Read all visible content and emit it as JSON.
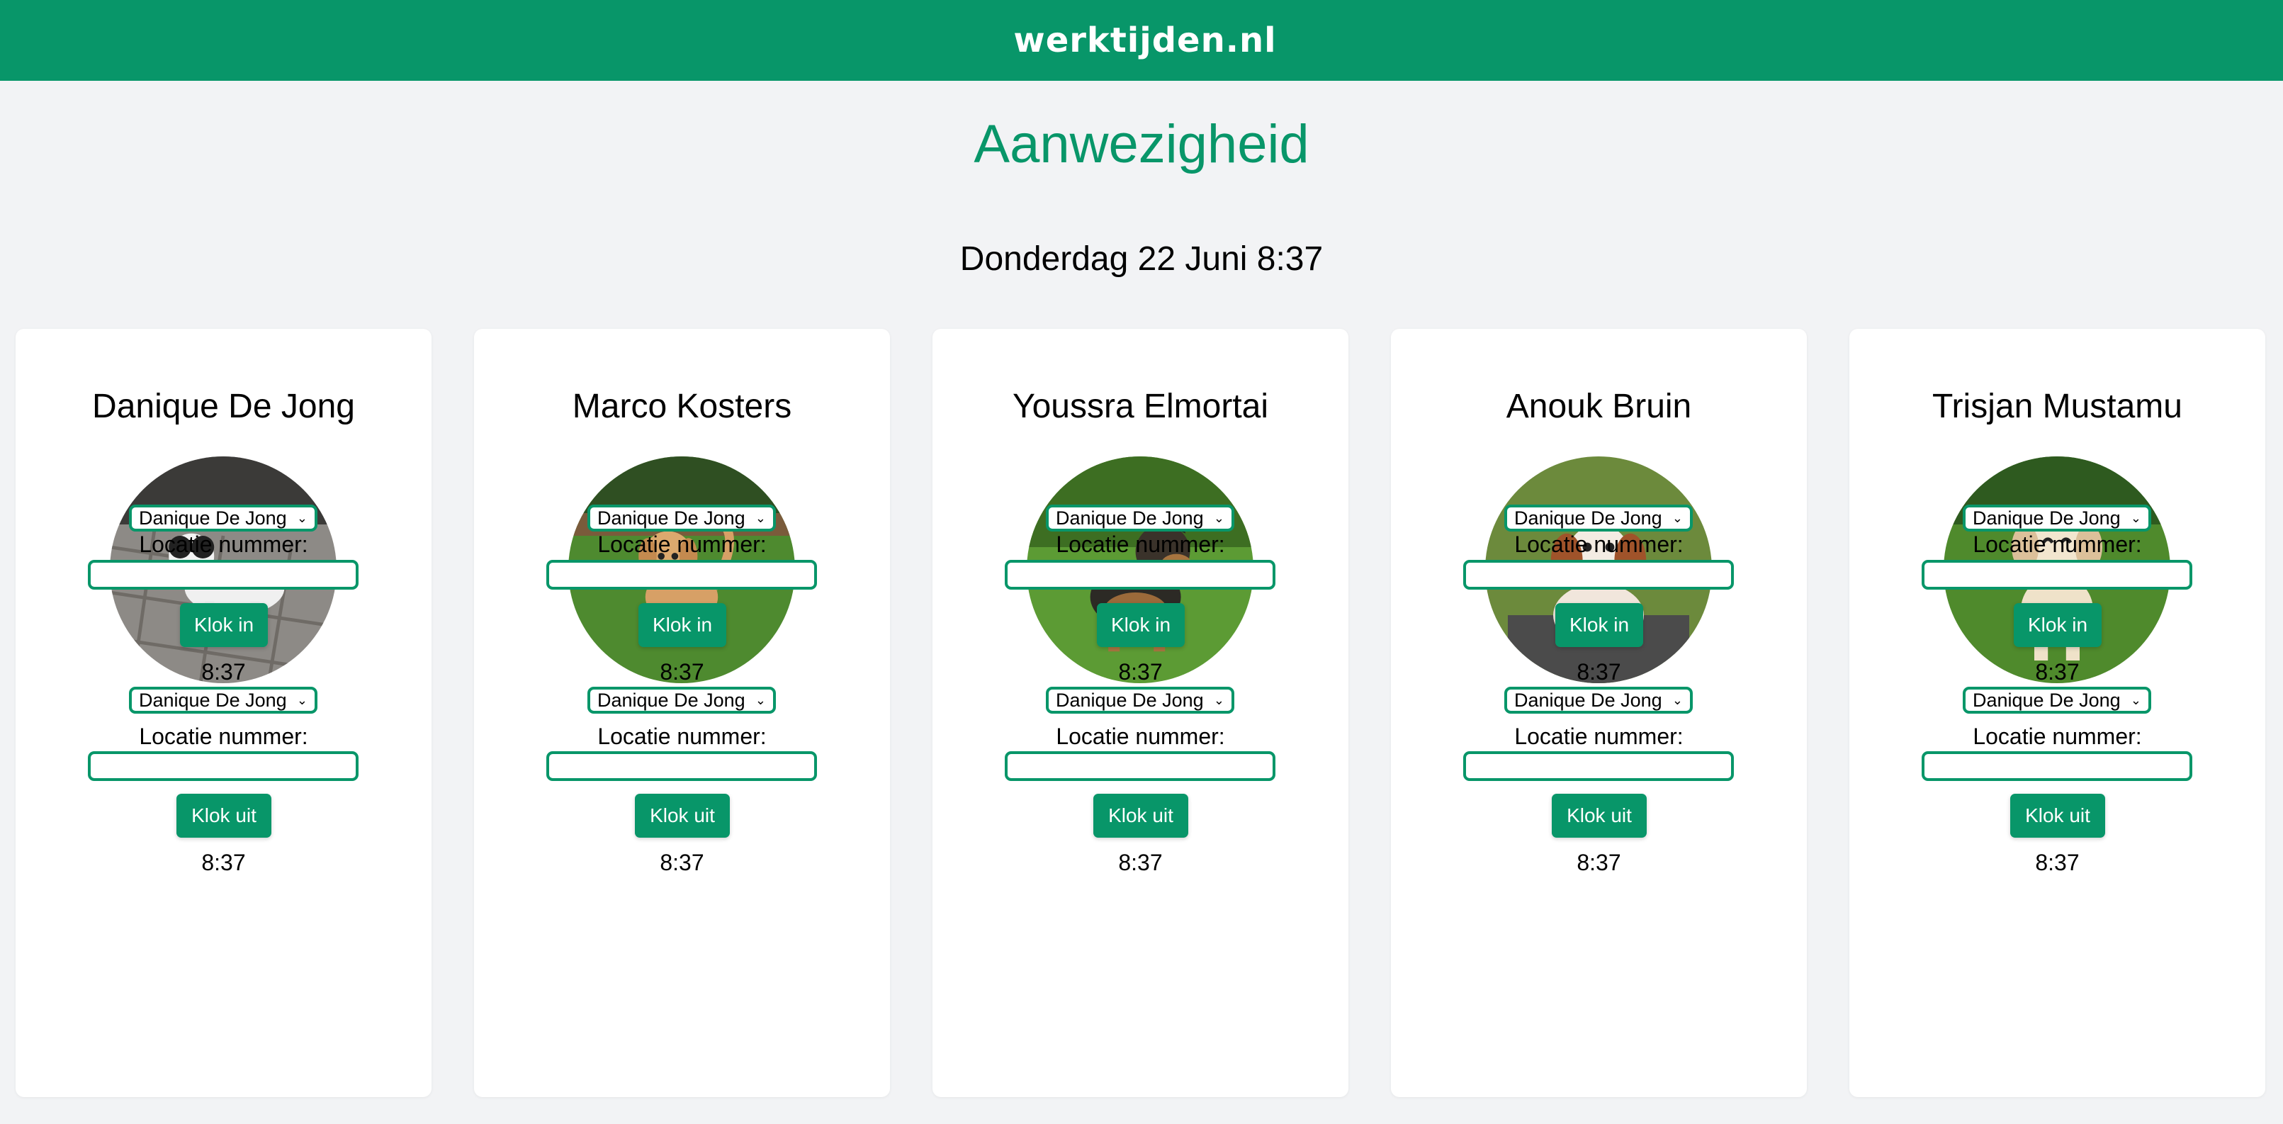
{
  "header": {
    "logo_text": "werktijden.nl"
  },
  "page": {
    "title": "Aanwezigheid",
    "datetime": "Donderdag 22 Juni 8:37"
  },
  "colors": {
    "brand": "#089669",
    "background": "#f2f3f5"
  },
  "cards": [
    {
      "name": "Danique De Jong",
      "avatar_icon": "puppy-shihtzu-photo",
      "clock_in": {
        "select_value": "Danique De Jong",
        "location_label": "Locatie nummer:",
        "location_value": "",
        "button_label": "Klok in",
        "time": "8:37"
      },
      "clock_out": {
        "select_value": "Danique De Jong",
        "location_label": "Locatie nummer:",
        "location_value": "",
        "button_label": "Klok uit",
        "time": "8:37"
      }
    },
    {
      "name": "Marco Kosters",
      "avatar_icon": "puppy-golden-retriever-photo",
      "clock_in": {
        "select_value": "Danique De Jong",
        "location_label": "Locatie nummer:",
        "location_value": "",
        "button_label": "Klok in",
        "time": "8:37"
      },
      "clock_out": {
        "select_value": "Danique De Jong",
        "location_label": "Locatie nummer:",
        "location_value": "",
        "button_label": "Klok uit",
        "time": "8:37"
      }
    },
    {
      "name": "Youssra Elmortai",
      "avatar_icon": "puppy-german-shepherd-photo",
      "clock_in": {
        "select_value": "Danique De Jong",
        "location_label": "Locatie nummer:",
        "location_value": "",
        "button_label": "Klok in",
        "time": "8:37"
      },
      "clock_out": {
        "select_value": "Danique De Jong",
        "location_label": "Locatie nummer:",
        "location_value": "",
        "button_label": "Klok uit",
        "time": "8:37"
      }
    },
    {
      "name": "Anouk Bruin",
      "avatar_icon": "puppy-cavapoo-photo",
      "clock_in": {
        "select_value": "Danique De Jong",
        "location_label": "Locatie nummer:",
        "location_value": "",
        "button_label": "Klok in",
        "time": "8:37"
      },
      "clock_out": {
        "select_value": "Danique De Jong",
        "location_label": "Locatie nummer:",
        "location_value": "",
        "button_label": "Klok uit",
        "time": "8:37"
      }
    },
    {
      "name": "Trisjan Mustamu",
      "avatar_icon": "puppy-golden-running-photo",
      "clock_in": {
        "select_value": "Danique De Jong",
        "location_label": "Locatie nummer:",
        "location_value": "",
        "button_label": "Klok in",
        "time": "8:37"
      },
      "clock_out": {
        "select_value": "Danique De Jong",
        "location_label": "Locatie nummer:",
        "location_value": "",
        "button_label": "Klok uit",
        "time": "8:37"
      }
    }
  ]
}
